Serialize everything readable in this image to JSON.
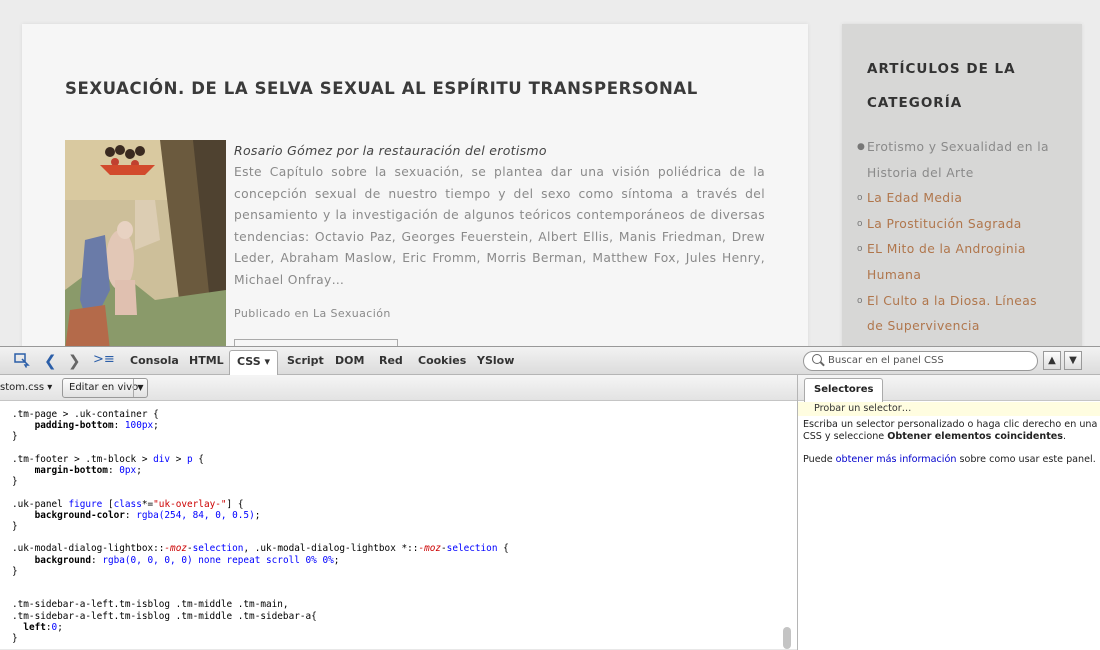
{
  "article": {
    "title": "SEXUACIÓN. DE LA SELVA SEXUAL AL ESPÍRITU TRANSPERSONAL",
    "author": "Rosario Gómez por la restauración del erotismo",
    "excerpt": "Este Capítulo sobre la sexuación,  se plantea dar una visión poliédrica de la concepción sexual de nuestro tiempo y del sexo como síntoma a través del pensamiento y la investigación de algunos teóricos contemporáneos de diversas tendencias: Octavio Paz, Georges Feuerstein, Albert Ellis, Manis Friedman, Drew Leder, Abraham Maslow, Eric Fromm, Morris Berman, Matthew Fox, Jules Henry, Michael Onfray…",
    "published_prefix": "Publicado en ",
    "published_category": "La Sexuación"
  },
  "sidebar": {
    "title": "ARTÍCULOS DE LA CATEGORÍA",
    "items": [
      {
        "label": "Erotismo y Sexualidad en la Historia del Arte",
        "bullet": "●",
        "current": true
      },
      {
        "label": "La Edad Media",
        "bullet": "o",
        "current": false
      },
      {
        "label": "La Prostitución Sagrada",
        "bullet": "o",
        "current": false
      },
      {
        "label": "EL Mito de la Androginia Humana",
        "bullet": "o",
        "current": false
      },
      {
        "label": "El Culto a la Diosa. Líneas de Supervivencia",
        "bullet": "o",
        "current": false
      }
    ]
  },
  "devtools": {
    "tabs": {
      "console": "Consola",
      "html": "HTML",
      "css": "CSS ▾",
      "script": "Script",
      "dom": "DOM",
      "net": "Red",
      "cookies": "Cookies",
      "yslow": "YSlow"
    },
    "search_placeholder": "Buscar en el panel CSS",
    "file_select": "stom.css ▾",
    "live_edit": "Editar en vivo",
    "side_tab": "Selectores",
    "probe": "Probar un selector…",
    "help_line1": "Escriba un selector personalizado o haga clic derecho en una reg",
    "help_line2_pre": "CSS y seleccione ",
    "help_line2_bold": "Obtener elementos coincidentes",
    "help_line2_post": ".",
    "help_line3_pre": "Puede ",
    "help_line3_link": "obtener más información",
    "help_line3_post": " sobre como usar este panel."
  },
  "colors": {
    "link": "#b0764c",
    "text_muted": "#8a8a8a",
    "firebug_blue": "#2b5ea8"
  }
}
